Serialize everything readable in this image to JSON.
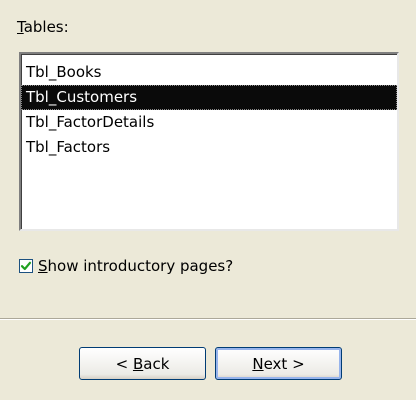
{
  "tables": {
    "label": "Tables:",
    "label_mnemonic": "T",
    "label_rest": "ables:",
    "items": [
      "Tbl_Books",
      "Tbl_Customers",
      "Tbl_FactorDetails",
      "Tbl_Factors"
    ],
    "selected_index": 1
  },
  "options": {
    "show_intro_label": "Show introductory pages?",
    "show_intro_mnemonic": "S",
    "show_intro_rest": "how introductory pages?",
    "show_intro_checked": true
  },
  "buttons": {
    "back_label": "< Back",
    "back_prefix": "< ",
    "back_mnemonic": "B",
    "back_rest": "ack",
    "next_label": "Next >",
    "next_mnemonic": "N",
    "next_rest": "ext >"
  },
  "colors": {
    "background": "#ece9d8",
    "selection": "#0a0a0a",
    "check": "#21a121",
    "button_border": "#003c74"
  }
}
